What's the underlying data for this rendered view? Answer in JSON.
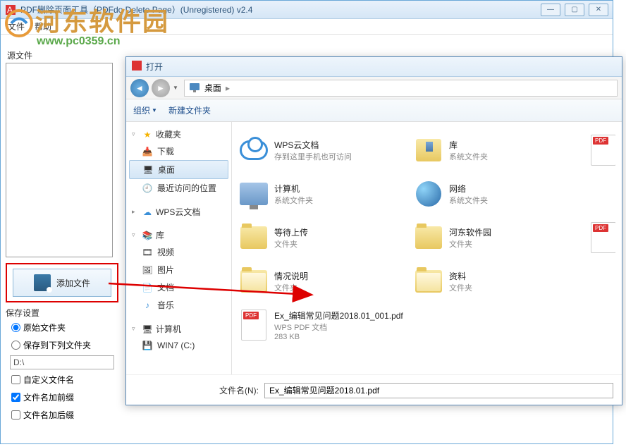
{
  "mainWindow": {
    "title": "PDF删除页面工具（PDFdo Delete Page）(Unregistered) v2.4",
    "menu": {
      "file": "文件",
      "help": "帮助"
    }
  },
  "watermark": {
    "cn": "河东软件园",
    "url": "www.pc0359.cn"
  },
  "leftPanel": {
    "sourceLabel": "源文件",
    "addFileBtn": "添加文件",
    "saveSettingsLabel": "保存设置",
    "radioOriginal": "原始文件夹",
    "radioSaveTo": "保存到下列文件夹",
    "pathValue": "D:\\",
    "chkCustomName": "自定义文件名",
    "chkAddPrefix": "文件名加前缀",
    "chkAddSuffix": "文件名加后缀"
  },
  "dialog": {
    "title": "打开",
    "breadcrumb": "桌面",
    "toolbar": {
      "organize": "组织",
      "newFolder": "新建文件夹"
    },
    "tree": {
      "favorites": {
        "label": "收藏夹",
        "items": [
          "下载",
          "桌面",
          "最近访问的位置"
        ]
      },
      "wps": "WPS云文档",
      "library": {
        "label": "库",
        "items": [
          "视频",
          "图片",
          "文档",
          "音乐"
        ]
      },
      "computer": {
        "label": "计算机",
        "items": [
          "WIN7 (C:)"
        ]
      }
    },
    "files": [
      {
        "name": "WPS云文档",
        "meta": "存到这里手机也可访问",
        "icon": "cloud"
      },
      {
        "name": "库",
        "meta": "系统文件夹",
        "icon": "lib"
      },
      {
        "name": "计算机",
        "meta": "系统文件夹",
        "icon": "monitor"
      },
      {
        "name": "网络",
        "meta": "系统文件夹",
        "icon": "globe"
      },
      {
        "name": "等待上传",
        "meta": "文件夹",
        "icon": "folder"
      },
      {
        "name": "河东软件园",
        "meta": "文件夹",
        "icon": "folder"
      },
      {
        "name": "情况说明",
        "meta": "文件夹",
        "icon": "folder-open"
      },
      {
        "name": "资料",
        "meta": "文件夹",
        "icon": "folder-open"
      },
      {
        "name": "Ex_编辑常见问题2018.01_001.pdf",
        "meta": "WPS PDF 文档",
        "meta2": "283 KB",
        "icon": "pdf"
      }
    ],
    "filenameLabel": "文件名(N):",
    "filenameValue": "Ex_编辑常见问题2018.01.pdf"
  }
}
